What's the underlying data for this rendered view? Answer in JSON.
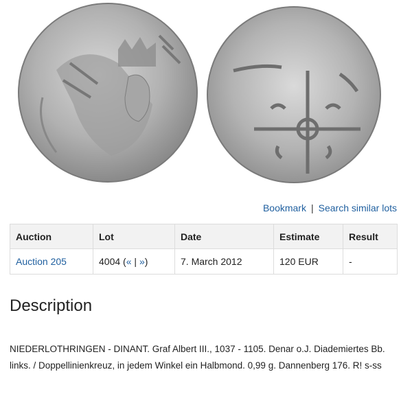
{
  "images": {
    "obverse": "coin-obverse-portrait",
    "reverse": "coin-reverse-cross"
  },
  "actions": {
    "bookmark": "Bookmark",
    "separator": "|",
    "search_similar": "Search similar lots"
  },
  "table": {
    "headers": [
      "Auction",
      "Lot",
      "Date",
      "Estimate",
      "Result"
    ],
    "row": {
      "auction": "Auction 205",
      "lot_number": "4004",
      "lot_open": "(",
      "prev": "«",
      "lot_sep": "|",
      "next": "»",
      "lot_close": ")",
      "date": "7. March 2012",
      "estimate": "120 EUR",
      "result": "-"
    }
  },
  "description": {
    "title": "Description",
    "text": "NIEDERLOTHRINGEN - DINANT. Graf Albert III., 1037 - 1105. Denar o.J. Diademiertes Bb. links. / Doppellinienkreuz, in jedem Winkel ein Halbmond. 0,99 g. Dannenberg 176. R! s-ss"
  },
  "colors": {
    "link": "#1f5f9f",
    "header_bg": "#f2f2f2",
    "border": "#dcdcdc",
    "coin_silver": "#b4b4b4"
  }
}
